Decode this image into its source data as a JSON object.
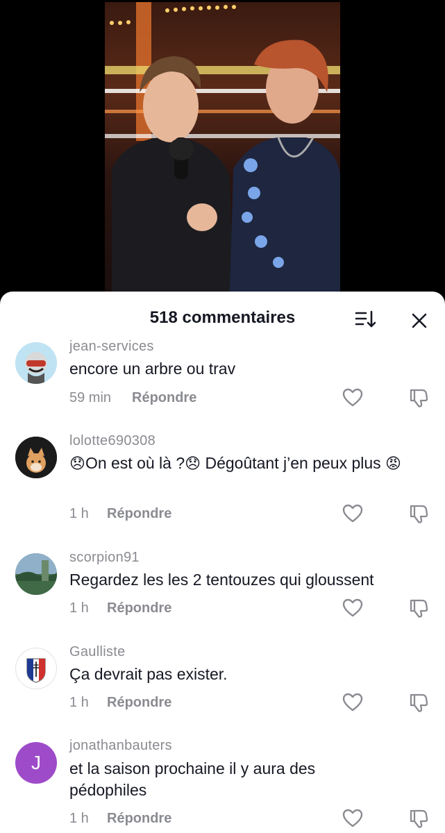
{
  "header": {
    "title": "518 commentaires",
    "sort_icon": "sort-icon",
    "close_icon": "close-icon"
  },
  "comments": [
    {
      "username": "jean-services",
      "text": "encore un arbre ou trav",
      "time": "59 min",
      "reply": "Répondre",
      "avatar": "avatar-robot-helmet"
    },
    {
      "username": "lolotte690308",
      "text_parts": [
        "😞",
        "On est où là ?",
        "😞",
        " Dégoûtant j’en peux plus ",
        "😡"
      ],
      "time": "1 h",
      "reply": "Répondre",
      "avatar": "avatar-shiba-dog"
    },
    {
      "username": "scorpion91",
      "text": "Regardez les les 2 tentouzes qui gloussent",
      "time": "1 h",
      "reply": "Répondre",
      "avatar": "avatar-landscape"
    },
    {
      "username": "Gaulliste",
      "text": "Ça devrait pas exister.",
      "time": "1 h",
      "reply": "Répondre",
      "avatar": "avatar-lorraine-cross-shield"
    },
    {
      "username": "jonathanbauters",
      "text": "et la saison prochaine il y aura des pédophiles",
      "time": "1 h",
      "reply": "Répondre",
      "avatar_initial": "J",
      "avatar": "avatar-initial"
    }
  ],
  "colors": {
    "accent_gray": "#8a8b91",
    "text": "#161823",
    "avatar_purple": "#9e4bc9"
  }
}
